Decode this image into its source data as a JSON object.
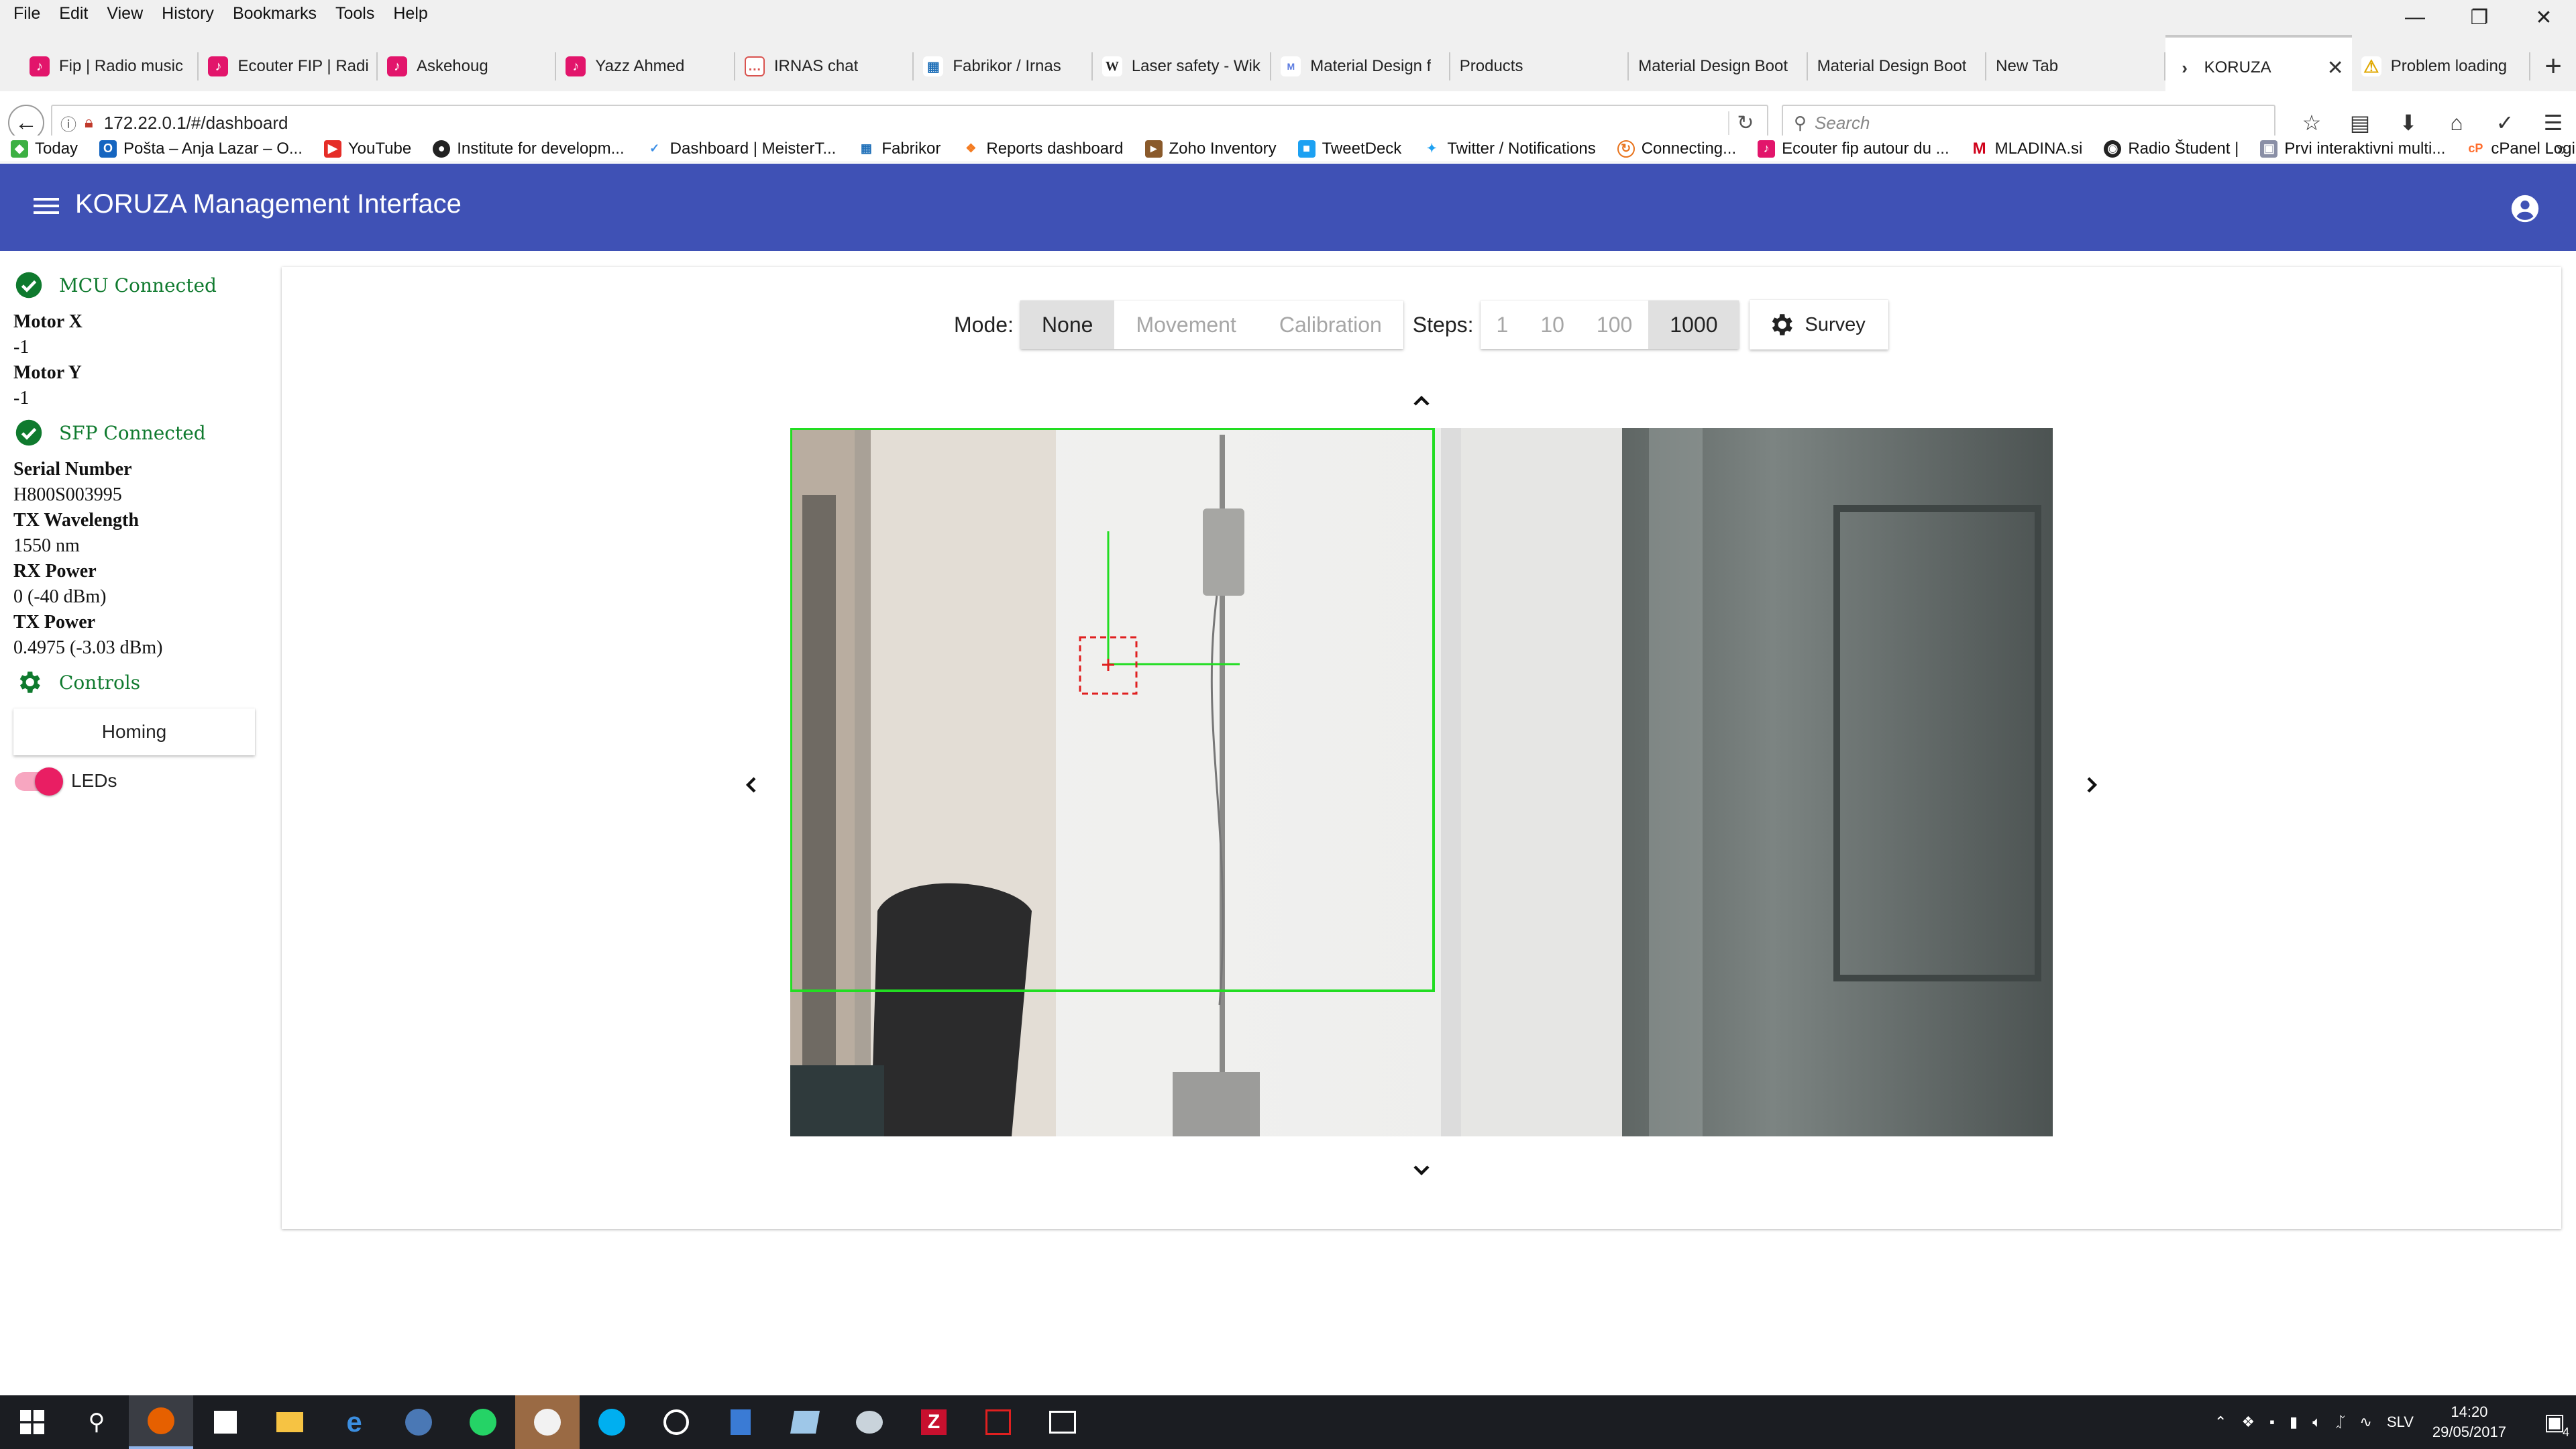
{
  "browser": {
    "menu": [
      "File",
      "Edit",
      "View",
      "History",
      "Bookmarks",
      "Tools",
      "Help"
    ],
    "tabs": [
      {
        "label": "Fip | Radio music",
        "favicon_color": "#e2156b"
      },
      {
        "label": "Ecouter FIP | Radi",
        "favicon_color": "#e2156b"
      },
      {
        "label": "Askehoug",
        "favicon_color": "#e2156b"
      },
      {
        "label": "Yazz Ahmed",
        "favicon_color": "#e2156b"
      },
      {
        "label": "IRNAS chat",
        "favicon_color": "#d9534f"
      },
      {
        "label": "Fabrikor / Irnas",
        "favicon_color": "#1e6fb8"
      },
      {
        "label": "Laser safety - Wik",
        "favicon_color": "#333333"
      },
      {
        "label": "Material Design f",
        "favicon_color": "#5b7be0"
      },
      {
        "label": "Products",
        "favicon_color": "#ffffff"
      },
      {
        "label": "Material Design Boot",
        "favicon_color": "#ffffff"
      },
      {
        "label": "Material Design Boot",
        "favicon_color": "#ffffff"
      },
      {
        "label": "New Tab",
        "favicon_color": "#ffffff"
      },
      {
        "label": "KORUZA",
        "favicon_color": "#ffffff",
        "active": true
      },
      {
        "label": "Problem loading",
        "favicon_color": "#f0b400"
      }
    ],
    "url": "172.22.0.1/#/dashboard",
    "search_placeholder": "Search",
    "bookmarks": [
      {
        "label": "Today",
        "color": "#3cb043"
      },
      {
        "label": "Pošta – Anja Lazar – O...",
        "color": "#1565c0"
      },
      {
        "label": "YouTube",
        "color": "#e52d27"
      },
      {
        "label": "Institute for developm...",
        "color": "#222222"
      },
      {
        "label": "Dashboard | MeisterT...",
        "color": "#3a8ee6"
      },
      {
        "label": "Fabrikor",
        "color": "#1e6fb8"
      },
      {
        "label": "Reports dashboard",
        "color": "#f47b20"
      },
      {
        "label": "Zoho Inventory",
        "color": "#8a5a2b"
      },
      {
        "label": "TweetDeck",
        "color": "#1da1f2"
      },
      {
        "label": "Twitter / Notifications",
        "color": "#1da1f2"
      },
      {
        "label": "Connecting...",
        "color": "#e8731c"
      },
      {
        "label": "Ecouter fip autour du ...",
        "color": "#e2156b"
      },
      {
        "label": "MLADINA.si",
        "color": "#d0021b"
      },
      {
        "label": "Radio Študent |",
        "color": "#222222"
      },
      {
        "label": "Prvi interaktivni multi...",
        "color": "#8a8fa6"
      },
      {
        "label": "cPanel Login",
        "color": "#ff6c2c"
      }
    ]
  },
  "app": {
    "title": "KORUZA Management Interface",
    "header_color": "#3f51b5",
    "sidebar": {
      "mcu_status": "MCU Connected",
      "motor_x_label": "Motor X",
      "motor_x_value": "-1",
      "motor_y_label": "Motor Y",
      "motor_y_value": "-1",
      "sfp_status": "SFP Connected",
      "serial_label": "Serial Number",
      "serial_value": "H800S003995",
      "tx_wavelength_label": "TX Wavelength",
      "tx_wavelength_value": "1550 nm",
      "rx_power_label": "RX Power",
      "rx_power_value": "0 (-40 dBm)",
      "tx_power_label": "TX Power",
      "tx_power_value": "0.4975 (-3.03 dBm)",
      "controls_label": "Controls",
      "homing_button": "Homing",
      "leds_label": "LEDs",
      "leds_on": true,
      "status_color": "#0f7a2e"
    },
    "toolbar": {
      "mode_label": "Mode:",
      "modes": [
        {
          "label": "None",
          "selected": true
        },
        {
          "label": "Movement",
          "selected": false
        },
        {
          "label": "Calibration",
          "selected": false
        }
      ],
      "steps_label": "Steps:",
      "steps": [
        {
          "label": "1",
          "selected": false
        },
        {
          "label": "10",
          "selected": false
        },
        {
          "label": "100",
          "selected": false
        },
        {
          "label": "1000",
          "selected": true
        }
      ],
      "survey_button": "Survey"
    },
    "camera": {
      "overlay_color": "#22dd22",
      "target_color": "#e02020"
    }
  },
  "taskbar": {
    "language": "SLV",
    "time": "14:20",
    "date": "29/05/2017",
    "notification_count": "4"
  }
}
